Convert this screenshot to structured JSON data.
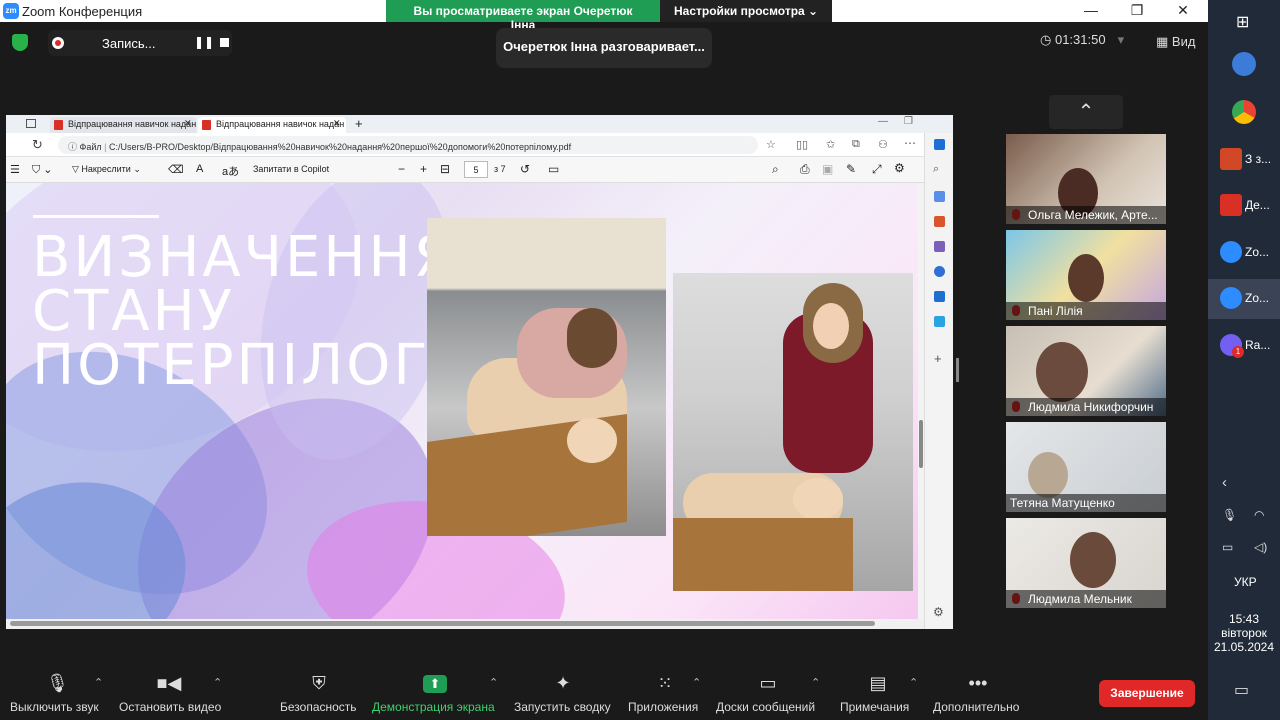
{
  "window": {
    "title": "Zoom Конференция",
    "logo": "zm",
    "min_icon": "minimize-icon",
    "max_icon": "restore-icon",
    "close_icon": "close-icon"
  },
  "share_banner": {
    "viewing": "Вы просматриваете экран Очеретюк Інна",
    "settings": "Настройки просмотра"
  },
  "top": {
    "record_label": "Запись...",
    "talking": "Очеретюк Інна разговаривает...",
    "timer": "01:31:50",
    "view_label": "Вид"
  },
  "browser": {
    "tabs": [
      "Відпрацювання навичок надан",
      "Відпрацювання навичок надан"
    ],
    "file_label": "Файл",
    "address": "C:/Users/B-PRO/Desktop/Відпрацювання%20навичок%20надання%20першої%20допомоги%20потерпілому.pdf",
    "draw_label": "Накреслити",
    "copilot_label": "Запитати в Copilot",
    "page_current": "5",
    "page_total": "з 7"
  },
  "slide": {
    "title_lines": [
      "ВИЗНАЧЕННЯ",
      "СТАНУ",
      "ПОТЕРПІЛОГО"
    ]
  },
  "participants": [
    {
      "name": "Ольга Мележик, Арте...",
      "muted": true
    },
    {
      "name": "Пані Лілія",
      "muted": true
    },
    {
      "name": "Людмила Никифорчин",
      "muted": true
    },
    {
      "name": "Тетяна Матущенко",
      "muted": false
    },
    {
      "name": "Людмила Мельник",
      "muted": true
    }
  ],
  "toolbar": {
    "mute": "Выключить звук",
    "video": "Остановить видео",
    "security": "Безопасность",
    "share": "Демонстрация экрана",
    "summary": "Запустить сводку",
    "apps": "Приложения",
    "boards": "Доски сообщений",
    "notes": "Примечания",
    "more": "Дополнительно",
    "end": "Завершение"
  },
  "taskbar": {
    "apps": [
      {
        "label": "З з..."
      },
      {
        "label": "Де..."
      },
      {
        "label": "Zo..."
      },
      {
        "label": "Zo..."
      },
      {
        "label": "Ra...",
        "badge": "1"
      }
    ],
    "lang": "УКР",
    "time": "15:43",
    "day": "вівторок",
    "date": "21.05.2024"
  },
  "colors": {
    "green": "#1f9d55",
    "end": "#e02828",
    "zoom_blue": "#2d8cff"
  }
}
